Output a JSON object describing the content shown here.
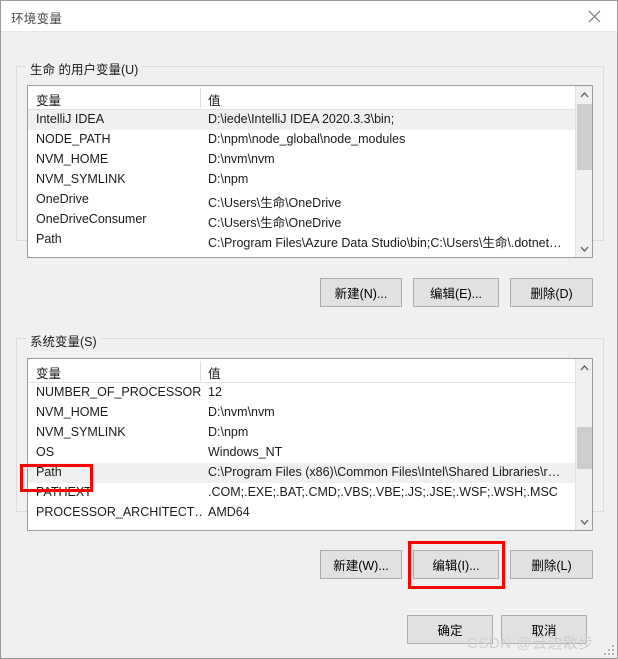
{
  "window": {
    "title": "环境变量",
    "close_icon": "close-icon"
  },
  "user_section": {
    "legend": "生命 的用户变量(U)",
    "columns": {
      "variable": "变量",
      "value": "值"
    },
    "rows": [
      {
        "variable": "IntelliJ IDEA",
        "value": "D:\\iede\\IntelliJ IDEA 2020.3.3\\bin;"
      },
      {
        "variable": "NODE_PATH",
        "value": "D:\\npm\\node_global\\node_modules"
      },
      {
        "variable": "NVM_HOME",
        "value": "D:\\nvm\\nvm"
      },
      {
        "variable": "NVM_SYMLINK",
        "value": "D:\\npm"
      },
      {
        "variable": "OneDrive",
        "value": "C:\\Users\\生命\\OneDrive"
      },
      {
        "variable": "OneDriveConsumer",
        "value": "C:\\Users\\生命\\OneDrive"
      },
      {
        "variable": "Path",
        "value": "C:\\Program Files\\Azure Data Studio\\bin;C:\\Users\\生命\\.dotnet…"
      }
    ],
    "selected_row_index": 0,
    "buttons": {
      "new": "新建(N)...",
      "edit": "编辑(E)...",
      "delete": "删除(D)"
    }
  },
  "system_section": {
    "legend": "系统变量(S)",
    "columns": {
      "variable": "变量",
      "value": "值"
    },
    "rows": [
      {
        "variable": "NUMBER_OF_PROCESSORS",
        "value": "12"
      },
      {
        "variable": "NVM_HOME",
        "value": "D:\\nvm\\nvm"
      },
      {
        "variable": "NVM_SYMLINK",
        "value": "D:\\npm"
      },
      {
        "variable": "OS",
        "value": "Windows_NT"
      },
      {
        "variable": "Path",
        "value": "C:\\Program Files (x86)\\Common Files\\Intel\\Shared Libraries\\r…"
      },
      {
        "variable": "PATHEXT",
        "value": ".COM;.EXE;.BAT;.CMD;.VBS;.VBE;.JS;.JSE;.WSF;.WSH;.MSC"
      },
      {
        "variable": "PROCESSOR_ARCHITECT…",
        "value": "AMD64"
      }
    ],
    "selected_row_index": 4,
    "buttons": {
      "new": "新建(W)...",
      "edit": "编辑(I)...",
      "delete": "删除(L)"
    }
  },
  "footer": {
    "ok": "确定",
    "cancel": "取消"
  },
  "annotations": {
    "color": "#ff0000",
    "highlight_path_row": "Path",
    "highlight_edit_button": "编辑(I)..."
  },
  "watermark": {
    "text": "CSDN @云边散步"
  }
}
